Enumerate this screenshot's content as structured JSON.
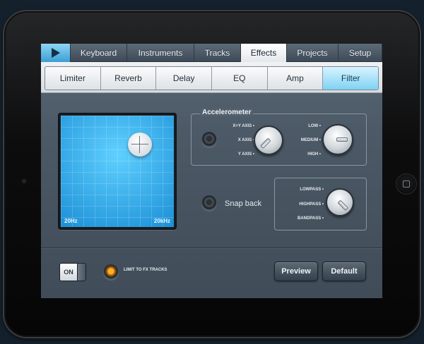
{
  "tabs": [
    {
      "label": ""
    },
    {
      "label": "Keyboard"
    },
    {
      "label": "Instruments"
    },
    {
      "label": "Tracks"
    },
    {
      "label": "Effects"
    },
    {
      "label": "Projects"
    },
    {
      "label": "Setup"
    }
  ],
  "active_tab": "Effects",
  "subtabs": [
    {
      "label": "Limiter"
    },
    {
      "label": "Reverb"
    },
    {
      "label": "Delay"
    },
    {
      "label": "EQ"
    },
    {
      "label": "Amp"
    },
    {
      "label": "Filter"
    }
  ],
  "active_subtab": "Filter",
  "xy_pad": {
    "min_label": "20Hz",
    "max_label": "20kHz"
  },
  "accelerometer": {
    "title": "Accelerometer",
    "axis_options": [
      "X+Y AXIS",
      "X AXIS",
      "Y AXIS"
    ],
    "sensitivity_options": [
      "LOW",
      "MEDIUM",
      "HIGH"
    ]
  },
  "snap_back": {
    "label": "Snap back"
  },
  "filter_type": {
    "options": [
      "LOWPASS",
      "HIGHPASS",
      "BANDPASS"
    ]
  },
  "power": {
    "label": "ON"
  },
  "limit_fx": {
    "label": "LIMIT TO FX TRACKS"
  },
  "buttons": {
    "preview": "Preview",
    "default": "Default"
  },
  "colors": {
    "accent": "#23a8ee",
    "active_subtab": "#7fd2f4",
    "led_on": "#ffb326"
  },
  "icons": [
    "play-icon",
    "crosshair-icon",
    "home-button-icon"
  ]
}
